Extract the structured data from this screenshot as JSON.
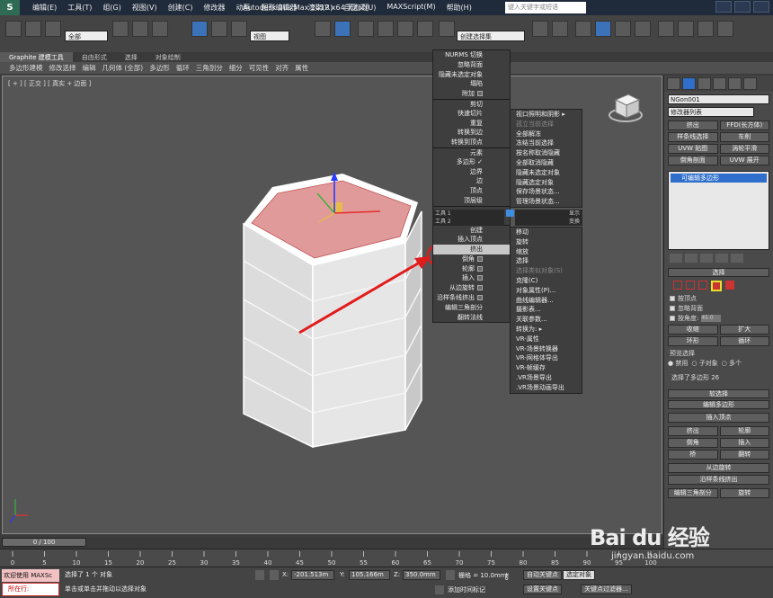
{
  "window": {
    "app_logo": "S",
    "title": "Autodesk 3ds Max  2012 x64     无标题",
    "search_placeholder": "键入关键字或短语"
  },
  "menus": [
    "编辑(E)",
    "工具(T)",
    "组(G)",
    "视图(V)",
    "创建(C)",
    "修改器",
    "动画",
    "图形编辑器",
    "渲染(R)",
    "自定义(U)",
    "MAXScript(M)",
    "帮助(H)"
  ],
  "toolbar": {
    "filter_dropdown": "全部",
    "view_dropdown": "视图",
    "named_selection": "创建选择集"
  },
  "ribbon": {
    "tabs": [
      "Graphite 建模工具",
      "自由形式",
      "选择",
      "对象绘制"
    ],
    "active_tab": 0,
    "row_items": [
      "多边形建模",
      "修改选择",
      "编辑",
      "几何体 (全部)",
      "多边形",
      "循环",
      "三角剖分",
      "细分",
      "可见性",
      "对齐",
      "属性"
    ]
  },
  "viewport": {
    "label": "[ + ] [ 正交 ] [ 真实 + 边面 ]"
  },
  "quad_menu": {
    "left_items": [
      {
        "label": "NURMS 切换",
        "sep": false
      },
      {
        "label": "忽略背面",
        "sep": false
      },
      {
        "label": "隐藏未选定对象",
        "sep": false
      },
      {
        "label": "塌陷",
        "sep": false
      },
      {
        "label": "附加",
        "sep": false,
        "box": true
      },
      {
        "label": "剪切",
        "sep": true
      },
      {
        "label": "快速切片",
        "sep": false
      },
      {
        "label": "重复",
        "sep": false
      },
      {
        "label": "转换到边",
        "sep": false
      },
      {
        "label": "转换到顶点",
        "sep": false
      },
      {
        "label": "元素",
        "sep": true
      },
      {
        "label": "多边形",
        "sep": false,
        "check": true
      },
      {
        "label": "边界",
        "sep": false
      },
      {
        "label": "边",
        "sep": false
      },
      {
        "label": "顶点",
        "sep": false
      },
      {
        "label": "顶层级",
        "sep": false
      },
      {
        "label": "",
        "sep": true
      },
      {
        "label": "",
        "sep": false
      },
      {
        "label": "创建",
        "sep": true
      },
      {
        "label": "插入顶点",
        "sep": false
      },
      {
        "label": "挤出",
        "sep": false,
        "selected": true
      },
      {
        "label": "倒角",
        "sep": false,
        "box": true
      },
      {
        "label": "轮廓",
        "sep": false,
        "box": true
      },
      {
        "label": "插入",
        "sep": false,
        "box": true
      },
      {
        "label": "从边旋转",
        "sep": false,
        "box": true
      },
      {
        "label": "沿样条线挤出",
        "sep": false,
        "box": true
      },
      {
        "label": "编辑三角剖分",
        "sep": false
      },
      {
        "label": "翻转法线",
        "sep": false
      }
    ],
    "right_top_items": [
      {
        "label": "视口照明和阴影 ▸",
        "disabled": false
      },
      {
        "label": "孤立当前选择",
        "disabled": true
      },
      {
        "label": "全部解冻",
        "disabled": false
      },
      {
        "label": "冻结当前选择",
        "disabled": false
      },
      {
        "label": "按名称取消隐藏",
        "disabled": false
      },
      {
        "label": "全部取消隐藏",
        "disabled": false
      },
      {
        "label": "隐藏未选定对象",
        "disabled": false
      },
      {
        "label": "隐藏选定对象",
        "disabled": false
      },
      {
        "label": "保存场景状态...",
        "disabled": false
      },
      {
        "label": "管理场景状态...",
        "disabled": false
      }
    ],
    "right_bottom_items": [
      {
        "label": "移动",
        "disabled": false
      },
      {
        "label": "旋转",
        "disabled": false
      },
      {
        "label": "缩放",
        "disabled": false
      },
      {
        "label": "选择",
        "disabled": false
      },
      {
        "label": "选择类似对象(S)",
        "disabled": true
      },
      {
        "label": "克隆(C)",
        "disabled": false
      },
      {
        "label": "对象属性(P)...",
        "disabled": false
      },
      {
        "label": "曲线编辑器...",
        "disabled": false
      },
      {
        "label": "摄影表...",
        "disabled": false
      },
      {
        "label": "关联参数...",
        "disabled": false
      },
      {
        "label": "转换为: ▸",
        "disabled": false
      },
      {
        "label": "VR-属性",
        "disabled": false
      },
      {
        "label": "VR-场景转换器",
        "disabled": false
      },
      {
        "label": "VR-网格体导出",
        "disabled": false
      },
      {
        "label": "VR-帧缓存",
        "disabled": false
      },
      {
        "label": ".VR场景导出",
        "disabled": false
      },
      {
        "label": ".VR场景动画导出",
        "disabled": false
      }
    ],
    "header_tools1": "工具 1",
    "header_tools2": "工具 2",
    "header_display": "显示",
    "header_transform": "变换"
  },
  "command_panel": {
    "object_name": "NGon001",
    "modifier_list": "修改器列表",
    "buttons": [
      "挤出",
      "FFD(长方体)",
      "样条线选择",
      "车削",
      "UVW 贴图",
      "涡轮平滑",
      "倒角剖面",
      "UVW 展开"
    ],
    "stack_item": "可编辑多边形",
    "selection": {
      "title": "选择",
      "by_vertex": "按顶点",
      "ignore_backface": "忽略背面",
      "by_angle": "按角度:",
      "angle_value": "45.0",
      "shrink": "收缩",
      "grow": "扩大",
      "ring": "环形",
      "loop": "循环",
      "preview_title": "预览选择",
      "preview_options": [
        "禁用",
        "子对象",
        "多个"
      ],
      "status": "选择了多边形 26"
    },
    "soft_selection": "软选择",
    "edit_polygons": {
      "title": "编辑多边形",
      "insert_vertex": "插入顶点",
      "extrude": "挤出",
      "outline": "轮廓",
      "bevel": "倒角",
      "inset": "插入",
      "bridge": "桥",
      "flip": "翻转",
      "hinge": "从边旋转",
      "extrude_spline": "沿样条线挤出",
      "edit_tri": "编辑三角剖分",
      "retriangulate": "旋转"
    }
  },
  "timeline": {
    "frame_display": "0 / 100",
    "ticks": [
      "0",
      "5",
      "10",
      "15",
      "20",
      "25",
      "30",
      "35",
      "40",
      "45",
      "50",
      "55",
      "60",
      "65",
      "70",
      "75",
      "80",
      "85",
      "90",
      "95",
      "100"
    ]
  },
  "status_bar": {
    "welcome": "欢迎使用 MAXSc",
    "mode": "所在行:",
    "selected": "选择了 1 个 对象",
    "hint": "单击或单击并拖动以选择对象",
    "x_label": "X:",
    "x": "-201.513m",
    "y_label": "Y:",
    "y": "105.166m",
    "z_label": "Z:",
    "z": "350.0mm",
    "grid": "栅格 = 10.0mm",
    "auto_key": "自动关键点",
    "selected_set": "选定对象",
    "set_key": "设置关键点",
    "key_filters": "关键点过滤器...",
    "add_time_tag": "添加时间标记"
  },
  "watermark": {
    "brand": "Bai du 经验",
    "url": "jingyan.baidu.com"
  },
  "colors": {
    "accent_blue": "#2f6fcb",
    "selected_face": "#e09a9a",
    "annotation_red": "#e11b1b"
  }
}
